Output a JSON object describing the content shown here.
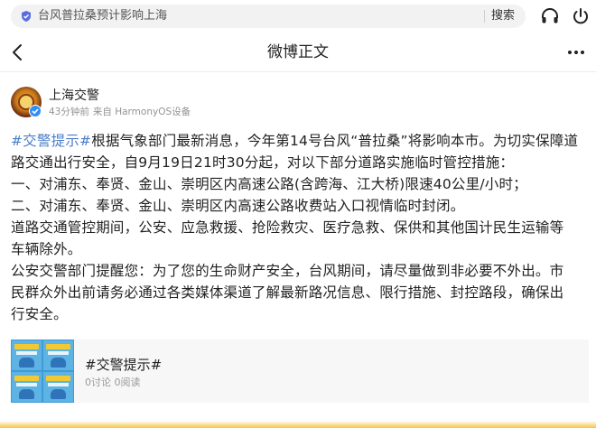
{
  "search": {
    "query": "台风普拉桑预计影响上海",
    "button_label": "搜索"
  },
  "nav": {
    "title": "微博正文"
  },
  "author": {
    "name": "上海交警",
    "time": "43分钟前",
    "source": "来自 HarmonyOS设备"
  },
  "post": {
    "hashtag": "#交警提示#",
    "line1_rest": "根据气象部门最新消息，今年第14号台风“普拉桑”将影响本市。为切实保障道",
    "line2": "路交通出行安全，自9月19日21时30分起，对以下部分道路实施临时管控措施：",
    "line3": "一、对浦东、奉贤、金山、崇明区内高速公路(含跨海、江大桥)限速40公里/小时；",
    "line4": "二、对浦东、奉贤、金山、崇明区内高速公路收费站入口视情临时封闭。",
    "line5": "道路交通管控期间，公安、应急救援、抢险救灾、医疗急救、保供和其他国计民生运输等",
    "line6": "车辆除外。",
    "line7": "公安交警部门提醒您：为了您的生命财产安全，台风期间，请尽量做到非必要不外出。市",
    "line8": "民群众外出前请务必通过各类媒体渠道了解最新路况信息、限行措施、封控路段，确保出",
    "line9": "行安全。"
  },
  "topic": {
    "title": "#交警提示#",
    "stats": "0讨论 0阅读"
  },
  "colors": {
    "hashtag": "#4a7dc7",
    "verified": "#2f8ef4"
  },
  "icons": [
    "shield-icon",
    "headset-icon",
    "power-icon",
    "back-icon",
    "more-icon",
    "verified-icon"
  ]
}
